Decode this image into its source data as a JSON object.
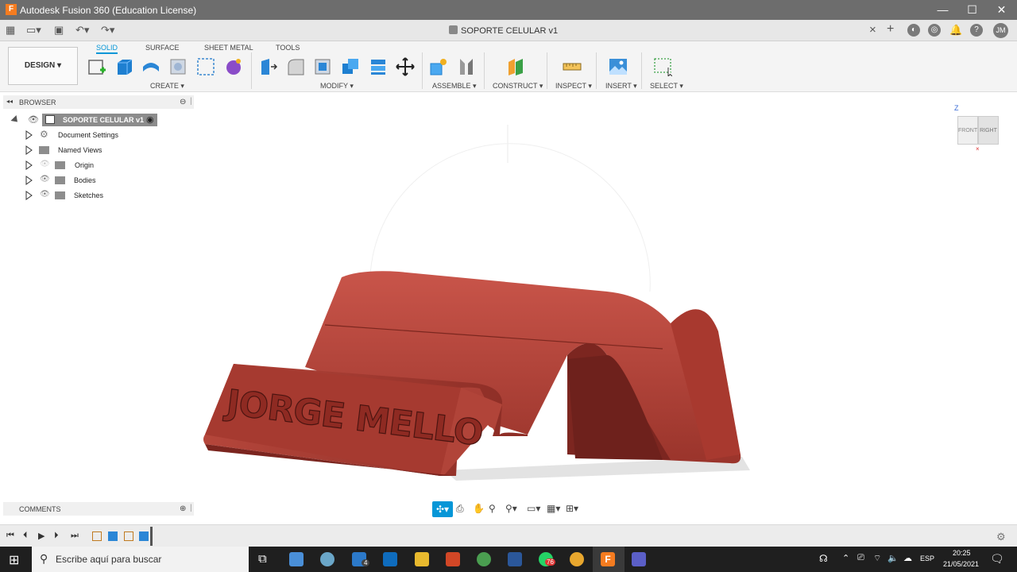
{
  "window": {
    "title": "Autodesk Fusion 360 (Education License)",
    "minimize": "—",
    "maximize": "☐",
    "close": "✕"
  },
  "document": {
    "tab_title": "SOPORTE CELULAR v1",
    "close": "×",
    "user_initials": "JM"
  },
  "toolbar": {
    "workspace": "DESIGN ▾",
    "tabs": [
      "SOLID",
      "SURFACE",
      "SHEET METAL",
      "TOOLS"
    ],
    "groups": [
      "CREATE ▾",
      "MODIFY ▾",
      "ASSEMBLE ▾",
      "CONSTRUCT ▾",
      "INSPECT ▾",
      "INSERT ▾",
      "SELECT ▾"
    ]
  },
  "browser": {
    "title": "BROWSER",
    "root": "SOPORTE CELULAR v1",
    "items": [
      "Document Settings",
      "Named Views",
      "Origin",
      "Bodies",
      "Sketches"
    ]
  },
  "viewcube": {
    "axis": "Z",
    "front": "FRONT",
    "right": "RIGHT"
  },
  "model": {
    "engraving": "JORGE MELLO",
    "color": "#a83a30"
  },
  "comments": {
    "title": "COMMENTS"
  },
  "taskbar": {
    "search_placeholder": "Escribe aquí para buscar",
    "lang": "ESP",
    "time": "20:25",
    "date": "21/05/2021",
    "mail_badge": "4",
    "whatsapp_badge": "76"
  }
}
